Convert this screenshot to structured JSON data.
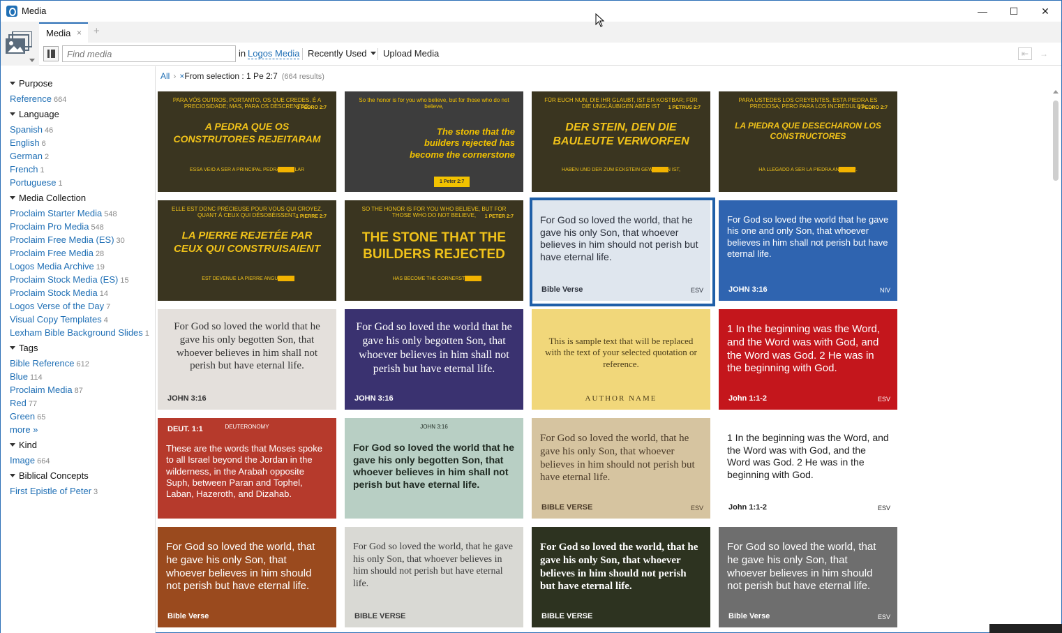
{
  "window": {
    "title": "Media",
    "minimize": "—",
    "maximize": "☐",
    "close": "✕"
  },
  "tabs": [
    {
      "label": "Media",
      "close": "×"
    }
  ],
  "tab_add": "+",
  "toolbar": {
    "search_placeholder": "Find media",
    "in_label": "in",
    "scope_link": "Logos Media",
    "sort_label": "Recently Used",
    "upload_label": "Upload Media"
  },
  "sidebar": {
    "groups": [
      {
        "title": "Purpose",
        "items": [
          {
            "label": "Reference",
            "count": "664"
          }
        ]
      },
      {
        "title": "Language",
        "items": [
          {
            "label": "Spanish",
            "count": "46"
          },
          {
            "label": "English",
            "count": "6"
          },
          {
            "label": "German",
            "count": "2"
          },
          {
            "label": "French",
            "count": "1"
          },
          {
            "label": "Portuguese",
            "count": "1"
          }
        ]
      },
      {
        "title": "Media Collection",
        "items": [
          {
            "label": "Proclaim Starter Media",
            "count": "548"
          },
          {
            "label": "Proclaim Pro Media",
            "count": "548"
          },
          {
            "label": "Proclaim Free Media (ES)",
            "count": "30"
          },
          {
            "label": "Proclaim Free Media",
            "count": "28"
          },
          {
            "label": "Logos Media Archive",
            "count": "19"
          },
          {
            "label": "Proclaim Stock Media (ES)",
            "count": "15"
          },
          {
            "label": "Proclaim Stock Media",
            "count": "14"
          },
          {
            "label": "Logos Verse of the Day",
            "count": "7"
          },
          {
            "label": "Visual Copy Templates",
            "count": "4"
          },
          {
            "label": "Lexham Bible Background Slides",
            "count": "1"
          }
        ]
      },
      {
        "title": "Tags",
        "items": [
          {
            "label": "Bible Reference",
            "count": "612"
          },
          {
            "label": "Blue",
            "count": "114"
          },
          {
            "label": "Proclaim Media",
            "count": "87"
          },
          {
            "label": "Red",
            "count": "77"
          },
          {
            "label": "Green",
            "count": "65"
          },
          {
            "label": "more »",
            "count": ""
          }
        ]
      },
      {
        "title": "Kind",
        "items": [
          {
            "label": "Image",
            "count": "664"
          }
        ]
      },
      {
        "title": "Biblical Concepts",
        "items": [
          {
            "label": "First Epistle of Peter",
            "count": "3"
          }
        ]
      }
    ]
  },
  "breadcrumb": {
    "all": "All",
    "separator": "›",
    "remove": "×",
    "selection": "From selection : 1 Pe 2:7",
    "results": "(664 results)"
  },
  "thumbnails": [
    {
      "main": "A PEDRA QUE OS CONSTRUTORES REJEITARAM",
      "top": "PARA VÓS OUTROS, PORTANTO, OS QUE CREDES, É A PRECIOSIDADE; MAS, PARA OS DESCRENTES,",
      "ref": "1 PEDRO 2:7",
      "bottom": "ESSA VEIO A SER A PRINCIPAL PEDRA ANGULAR",
      "bg": "#3a3520",
      "fg": "#f0c21a"
    },
    {
      "main": "The stone that the builders rejected has become the cornerstone",
      "top": "So the honor is for you who believe, but for those who do not believe,",
      "ref": "1 Peter 2:7",
      "bottom": "",
      "bg": "#3d3d3d",
      "fg": "#f2c200"
    },
    {
      "main": "DER STEIN, DEN DIE BAULEUTE VERWORFEN",
      "top": "FÜR EUCH NUN, DIE IHR GLAUBT, IST ER KOSTBAR; FÜR DIE UNGLÄUBIGEN ABER IST",
      "ref": "1 PETRUS 2:7",
      "bottom": "HABEN UND DER ZUM ECKSTEIN GEWORDEN IST,",
      "bg": "#3a3520",
      "fg": "#f0c21a"
    },
    {
      "main": "LA PIEDRA QUE DESECHARON LOS CONSTRUCTORES",
      "top": "PARA USTEDES LOS CREYENTES, ESTA PIEDRA ES PRECIOSA; PERO PARA LOS INCRÉDULOS,",
      "ref": "1 PEDRO 2:7",
      "bottom": "HA LLEGADO A SER LA PIEDRA ANGULAR.",
      "bg": "#3a3520",
      "fg": "#f0c21a"
    },
    {
      "main": "LA PIERRE REJETÉE PAR CEUX QUI CONSTRUISAIENT",
      "top": "ELLE EST DONC PRÉCIEUSE POUR VOUS QUI CROYEZ. QUANT À CEUX QUI DÉSOBÉISSENT,",
      "ref": "1 PIERRE 2:7",
      "bottom": "EST DEVENUE LA PIERRE ANGULAIRE",
      "bg": "#3a3520",
      "fg": "#f0c21a"
    },
    {
      "main": "THE STONE THAT THE BUILDERS REJECTED",
      "top": "SO THE HONOR IS FOR YOU WHO BELIEVE, BUT FOR THOSE WHO DO NOT BELIEVE,",
      "ref": "1 PETER 2:7",
      "bottom": "HAS BECOME THE CORNERSTONE",
      "bg": "#3a3520",
      "fg": "#f0c21a"
    },
    {
      "main": "For God so loved the world, that he gave his only Son, that whoever believes in him should not perish but have eternal life.",
      "top": "",
      "ref": "Bible Verse",
      "bottom": "ESV",
      "bg": "#dfe6ee",
      "fg": "#2a2f3a"
    },
    {
      "main": "For God so loved the world that he gave his one and only Son, that whoever believes in him shall not perish but have eternal life.",
      "top": "",
      "ref": "JOHN 3:16",
      "bottom": "NIV",
      "bg": "#2f64b0",
      "fg": "#ffffff"
    },
    {
      "main": "For God so loved the world that he gave his only begotten Son, that whoever believes in him shall not perish but have eternal life.",
      "top": "",
      "ref": "JOHN 3:16",
      "bottom": "",
      "bg": "#e4e0dc",
      "fg": "#333"
    },
    {
      "main": "For God so loved the world that he gave his only begotten Son, that whoever believes in him shall not perish but have eternal life.",
      "top": "",
      "ref": "JOHN 3:16",
      "bottom": "",
      "bg": "#3a3270",
      "fg": "#ffffff"
    },
    {
      "main": "This is sample text that will be replaced with the text of your selected quotation or reference.",
      "top": "",
      "ref": "AUTHOR NAME",
      "bottom": "",
      "bg": "#f1d77a",
      "fg": "#4a3c1a"
    },
    {
      "main": "1 In the beginning was the Word, and the Word was with God, and the Word was God. 2 He was in the beginning with God.",
      "top": "",
      "ref": "John 1:1-2",
      "bottom": "ESV",
      "bg": "#c4161c",
      "fg": "#ffffff"
    },
    {
      "main": "These are the words that Moses spoke to all Israel beyond the Jordan in the wilderness, in the Arabah opposite Suph, between Paran and Tophel, Laban, Hazeroth, and Dizahab.",
      "top": "DEUTERONOMY",
      "ref": "DEUT. 1:1",
      "bottom": "",
      "bg": "#b63a2c",
      "fg": "#ffffff"
    },
    {
      "main": "For God so loved the world that he gave his only begotten Son, that whoever believes in him shall not perish but have eternal life.",
      "top": "JOHN 3:16",
      "ref": "",
      "bottom": "",
      "bg": "#b8cfc4",
      "fg": "#1f2a22"
    },
    {
      "main": "For God so loved the world, that he gave his only Son, that whoever believes in him should not perish but have eternal life.",
      "top": "",
      "ref": "BIBLE VERSE",
      "bottom": "ESV",
      "bg": "#d6c4a0",
      "fg": "#4a3a28"
    },
    {
      "main": "1 In the beginning was the Word, and the Word was with God, and the Word was God. 2 He was in the beginning with God.",
      "top": "",
      "ref": "John 1:1-2",
      "bottom": "ESV",
      "bg": "#ffffff",
      "fg": "#222"
    },
    {
      "main": "For God so loved the world, that he gave his only Son, that whoever believes in him should not perish but have eternal life.",
      "top": "",
      "ref": "Bible Verse",
      "bottom": "",
      "bg": "#9a4a1e",
      "fg": "#ffffff"
    },
    {
      "main": "For God so loved the world, that he gave his only Son, that whoever believes in him should not perish but have eternal life.",
      "top": "",
      "ref": "BIBLE VERSE",
      "bottom": "",
      "bg": "#d9d9d4",
      "fg": "#3a3a3a"
    },
    {
      "main": "For God so loved the world, that he gave his only Son, that whoever believes in him should not perish but have eternal life.",
      "top": "",
      "ref": "BIBLE VERSE",
      "bottom": "",
      "bg": "#2d3320",
      "fg": "#ffffff"
    },
    {
      "main": "For God so loved the world, that he gave his only Son, that whoever believes in him should not perish but have eternal life.",
      "top": "",
      "ref": "Bible Verse",
      "bottom": "ESV",
      "bg": "#6e6e6e",
      "fg": "#ffffff"
    }
  ],
  "colors": {
    "accent": "#1f6fb5",
    "selection": "#1f5fa8"
  }
}
